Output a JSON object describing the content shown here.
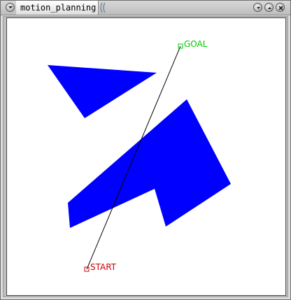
{
  "window": {
    "title": "motion_planning"
  },
  "icons": {
    "window_menu": "chevron-down-icon",
    "minimize": "minimize-icon",
    "maximize": "maximize-icon",
    "close": "close-icon"
  },
  "scene": {
    "start_label": "START",
    "goal_label": "GOAL",
    "colors": {
      "obstacle": "#0000ff",
      "start": "#cc0000",
      "goal": "#00cc00",
      "path": "#000000",
      "background": "#ffffff"
    }
  }
}
